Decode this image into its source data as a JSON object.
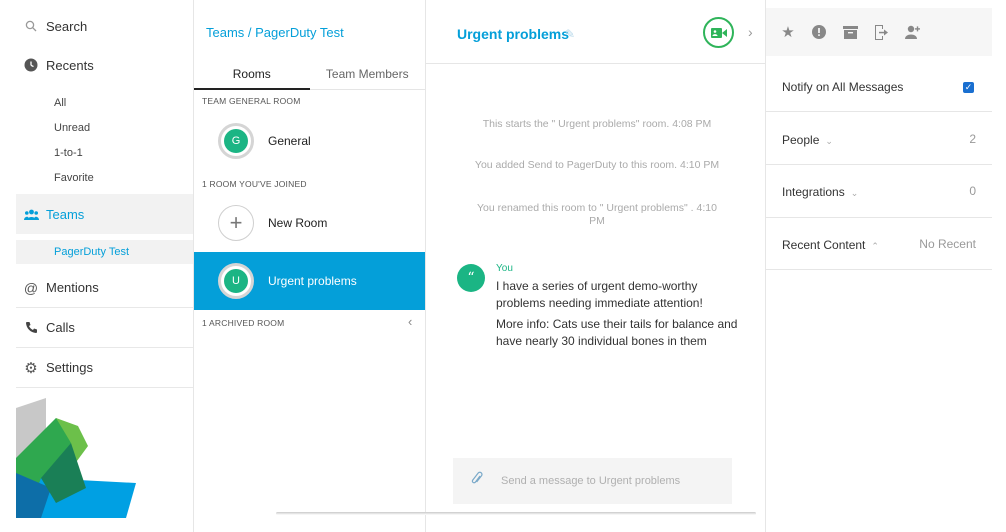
{
  "nav": {
    "search_label": "Search",
    "recents_label": "Recents",
    "recents_filters": [
      "All",
      "Unread",
      "1-to-1",
      "Favorite"
    ],
    "teams_label": "Teams",
    "selected_team": "PagerDuty Test",
    "mentions_label": "Mentions",
    "calls_label": "Calls",
    "settings_label": "Settings"
  },
  "rooms_panel": {
    "breadcrumb": "Teams / PagerDuty Test",
    "tabs": [
      {
        "label": "Rooms",
        "active": true
      },
      {
        "label": "Team Members",
        "active": false
      }
    ],
    "general_section_label": "TEAM GENERAL ROOM",
    "general_room": {
      "name": "General",
      "initial": "G"
    },
    "joined_section_label": "1 ROOM YOU'VE JOINED",
    "new_room_label": "New Room",
    "joined_room": {
      "name": "Urgent problems",
      "initial": "U",
      "selected": true
    },
    "archived_section_label": "1 ARCHIVED ROOM"
  },
  "conversation": {
    "title": "Urgent problems",
    "system_messages": [
      "This starts the \" Urgent problems\" room. 4:08 PM",
      "You added Send to PagerDuty to this room. 4:10 PM",
      "You renamed this room to \" Urgent problems\" . 4:10 PM"
    ],
    "message": {
      "sender": "You",
      "avatar_glyph": "“",
      "lines": [
        "I have a series of urgent demo-worthy problems needing immediate attention!",
        "More info: Cats use their tails for balance and have nearly 30 individual bones in them"
      ]
    },
    "composer_placeholder": "Send a message to Urgent problems"
  },
  "details": {
    "notify_label": "Notify on All Messages",
    "notify_checked": true,
    "people_label": "People",
    "people_count": "2",
    "integrations_label": "Integrations",
    "integrations_count": "0",
    "recent_content_label": "Recent Content",
    "recent_content_value": "No Recent"
  },
  "colors": {
    "accent": "#049fd9",
    "avatar_green": "#1bb584",
    "video_green": "#2fb45a",
    "checkbox_blue": "#1a6fd0"
  }
}
